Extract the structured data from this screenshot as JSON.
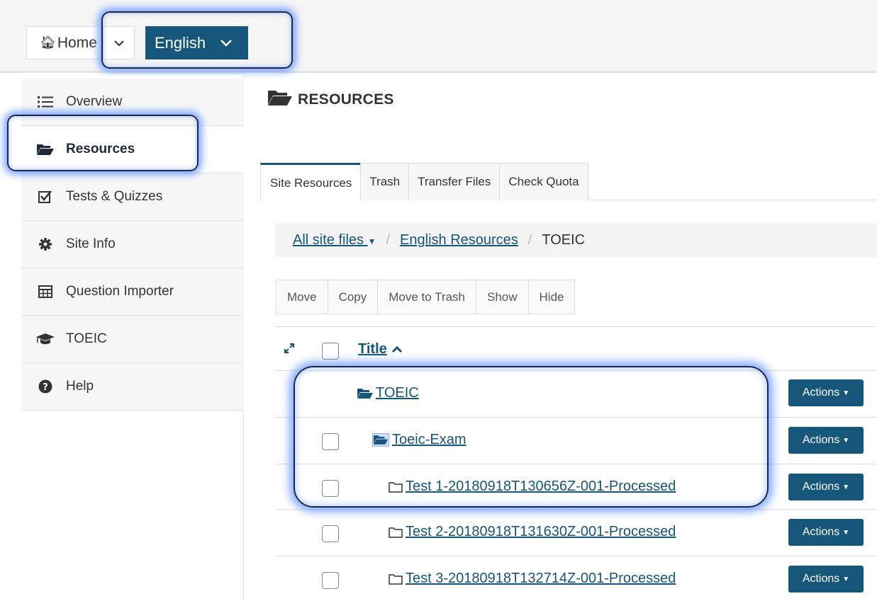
{
  "topbar": {
    "home_label": "Home",
    "language_label": "English"
  },
  "sidebar": {
    "items": [
      {
        "label": "Overview",
        "icon": "list-icon"
      },
      {
        "label": "Resources",
        "icon": "folder-open-icon"
      },
      {
        "label": "Tests & Quizzes",
        "icon": "checkbox-icon"
      },
      {
        "label": "Site Info",
        "icon": "gear-icon"
      },
      {
        "label": "Question Importer",
        "icon": "table-icon"
      },
      {
        "label": "TOEIC",
        "icon": "graduation-cap-icon"
      },
      {
        "label": "Help",
        "icon": "question-circle-icon"
      }
    ],
    "active": "Resources"
  },
  "page": {
    "title": "RESOURCES"
  },
  "tabs": [
    "Site Resources",
    "Trash",
    "Transfer Files",
    "Check Quota"
  ],
  "breadcrumb": {
    "root": "All site files",
    "folder": "English Resources",
    "current": "TOEIC",
    "separator": "/"
  },
  "toolbar": [
    "Move",
    "Copy",
    "Move to Trash",
    "Show",
    "Hide"
  ],
  "table": {
    "title_header": "Title",
    "rows": [
      {
        "name": "TOEIC",
        "type": "folder-open"
      },
      {
        "name": "Toeic-Exam",
        "type": "folder-open"
      },
      {
        "name": "Test 1-20180918T130656Z-001-Processed",
        "type": "folder"
      },
      {
        "name": "Test 2-20180918T131630Z-001-Processed",
        "type": "folder"
      },
      {
        "name": "Test 3-20180918T132714Z-001-Processed",
        "type": "folder"
      }
    ],
    "actions_label": "Actions"
  },
  "colors": {
    "accent": "#15567a",
    "highlight_glow": "#5a8cff"
  }
}
